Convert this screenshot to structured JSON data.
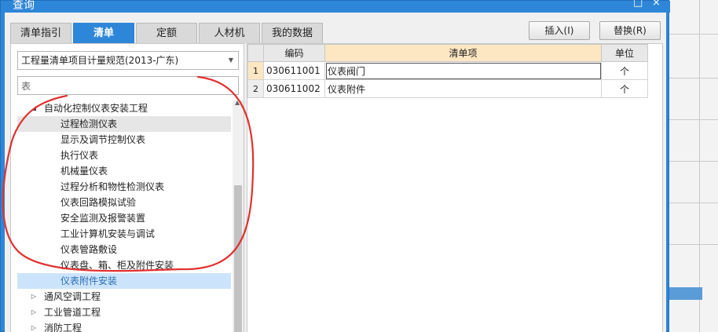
{
  "window": {
    "title": "查询",
    "controls": [
      "□",
      "×"
    ]
  },
  "tabs": [
    {
      "label": "清单指引",
      "active": false
    },
    {
      "label": "清单",
      "active": true
    },
    {
      "label": "定额",
      "active": false
    },
    {
      "label": "人材机",
      "active": false
    },
    {
      "label": "我的数据",
      "active": false
    }
  ],
  "toolbar": {
    "insert_label": "插入(I)",
    "replace_label": "替换(R)"
  },
  "left": {
    "standard_select": "工程量清单项目计量规范(2013-广东)",
    "search_value": "表",
    "tree": [
      {
        "label": "自动化控制仪表安装工程",
        "level": 1,
        "expander": "◢",
        "state": ""
      },
      {
        "label": "过程检测仪表",
        "level": 2,
        "expander": "",
        "state": "gray"
      },
      {
        "label": "显示及调节控制仪表",
        "level": 2,
        "expander": "",
        "state": ""
      },
      {
        "label": "执行仪表",
        "level": 2,
        "expander": "",
        "state": ""
      },
      {
        "label": "机械量仪表",
        "level": 2,
        "expander": "",
        "state": ""
      },
      {
        "label": "过程分析和物性检测仪表",
        "level": 2,
        "expander": "",
        "state": ""
      },
      {
        "label": "仪表回路模拟试验",
        "level": 2,
        "expander": "",
        "state": ""
      },
      {
        "label": "安全监测及报警装置",
        "level": 2,
        "expander": "",
        "state": ""
      },
      {
        "label": "工业计算机安装与调试",
        "level": 2,
        "expander": "",
        "state": ""
      },
      {
        "label": "仪表管路敷设",
        "level": 2,
        "expander": "",
        "state": ""
      },
      {
        "label": "仪表盘、箱、柜及附件安装",
        "level": 2,
        "expander": "",
        "state": ""
      },
      {
        "label": "仪表附件安装",
        "level": 2,
        "expander": "",
        "state": "blue"
      },
      {
        "label": "通风空调工程",
        "level": 1,
        "expander": "▷",
        "state": ""
      },
      {
        "label": "工业管道工程",
        "level": 1,
        "expander": "▷",
        "state": ""
      },
      {
        "label": "消防工程",
        "level": 1,
        "expander": "▷",
        "state": ""
      }
    ]
  },
  "grid": {
    "columns": [
      "编码",
      "清单项",
      "单位"
    ],
    "rows": [
      {
        "num": "1",
        "code": "030611001",
        "name": "仪表阀门",
        "unit": "个"
      },
      {
        "num": "2",
        "code": "030611002",
        "name": "仪表附件",
        "unit": "个"
      }
    ]
  },
  "colors": {
    "accent": "#2e86d8",
    "header_highlight": "#fde6c2",
    "selection_blue": "#cce4fb",
    "annotation_red": "#e23030"
  }
}
